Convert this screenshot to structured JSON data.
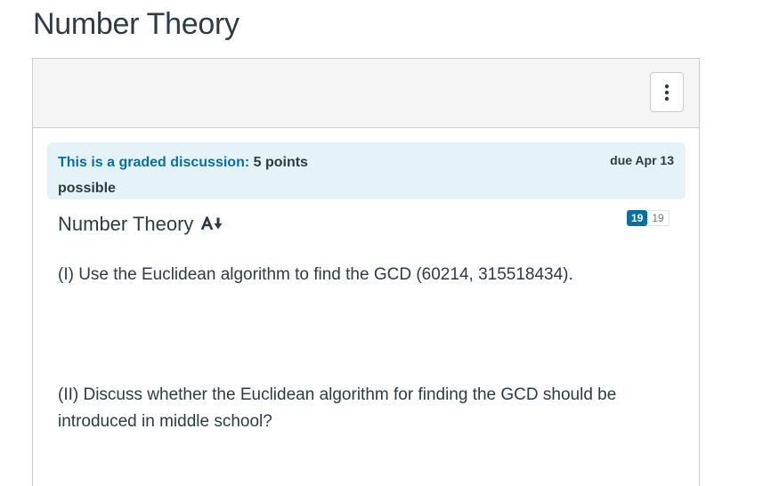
{
  "page": {
    "title": "Number Theory"
  },
  "toolbar": {
    "more_icon": "kebab-vertical-icon"
  },
  "banner": {
    "link_text": "This is a graded discussion:",
    "points_text": " 5 points possible",
    "due_text": "due Apr 13",
    "background": "#e5f2f8",
    "link_color": "#0770a3"
  },
  "topic": {
    "heading": "Number Theory",
    "heading_icon": "a-plus-icon",
    "unread_count": "19",
    "total_count": "19"
  },
  "content": {
    "question_1": "(I) Use the Euclidean algorithm to find the GCD (60214, 315518434).",
    "question_2": "(II) Discuss whether the Euclidean algorithm for finding the GCD should be introduced in middle school?"
  }
}
